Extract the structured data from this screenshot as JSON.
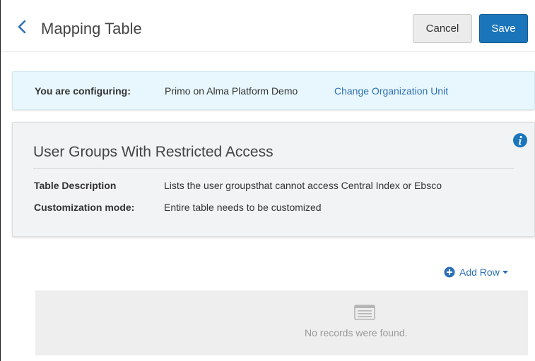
{
  "header": {
    "title": "Mapping Table",
    "cancel_label": "Cancel",
    "save_label": "Save"
  },
  "config": {
    "label": "You are configuring:",
    "value": "Primo on Alma Platform Demo",
    "link": "Change Organization Unit"
  },
  "table": {
    "title": "User Groups With Restricted Access",
    "description_label": "Table Description",
    "description_value": "Lists the user groupsthat cannot access Central Index or Ebsco",
    "mode_label": "Customization mode:",
    "mode_value": "Entire table needs to be customized"
  },
  "actions": {
    "add_row_label": "Add Row"
  },
  "empty_state": {
    "message": "No records were found."
  },
  "colors": {
    "primary": "#1b75bb",
    "link": "#2d6fb6",
    "config_bg": "#e8f7fd",
    "card_bg": "#f1f3f4",
    "empty_bg": "#eeeeee"
  },
  "icons": {
    "back": "chevron-left-icon",
    "info": "info-icon",
    "add": "plus-circle-icon",
    "dropdown": "caret-down-icon",
    "empty": "list-icon"
  }
}
